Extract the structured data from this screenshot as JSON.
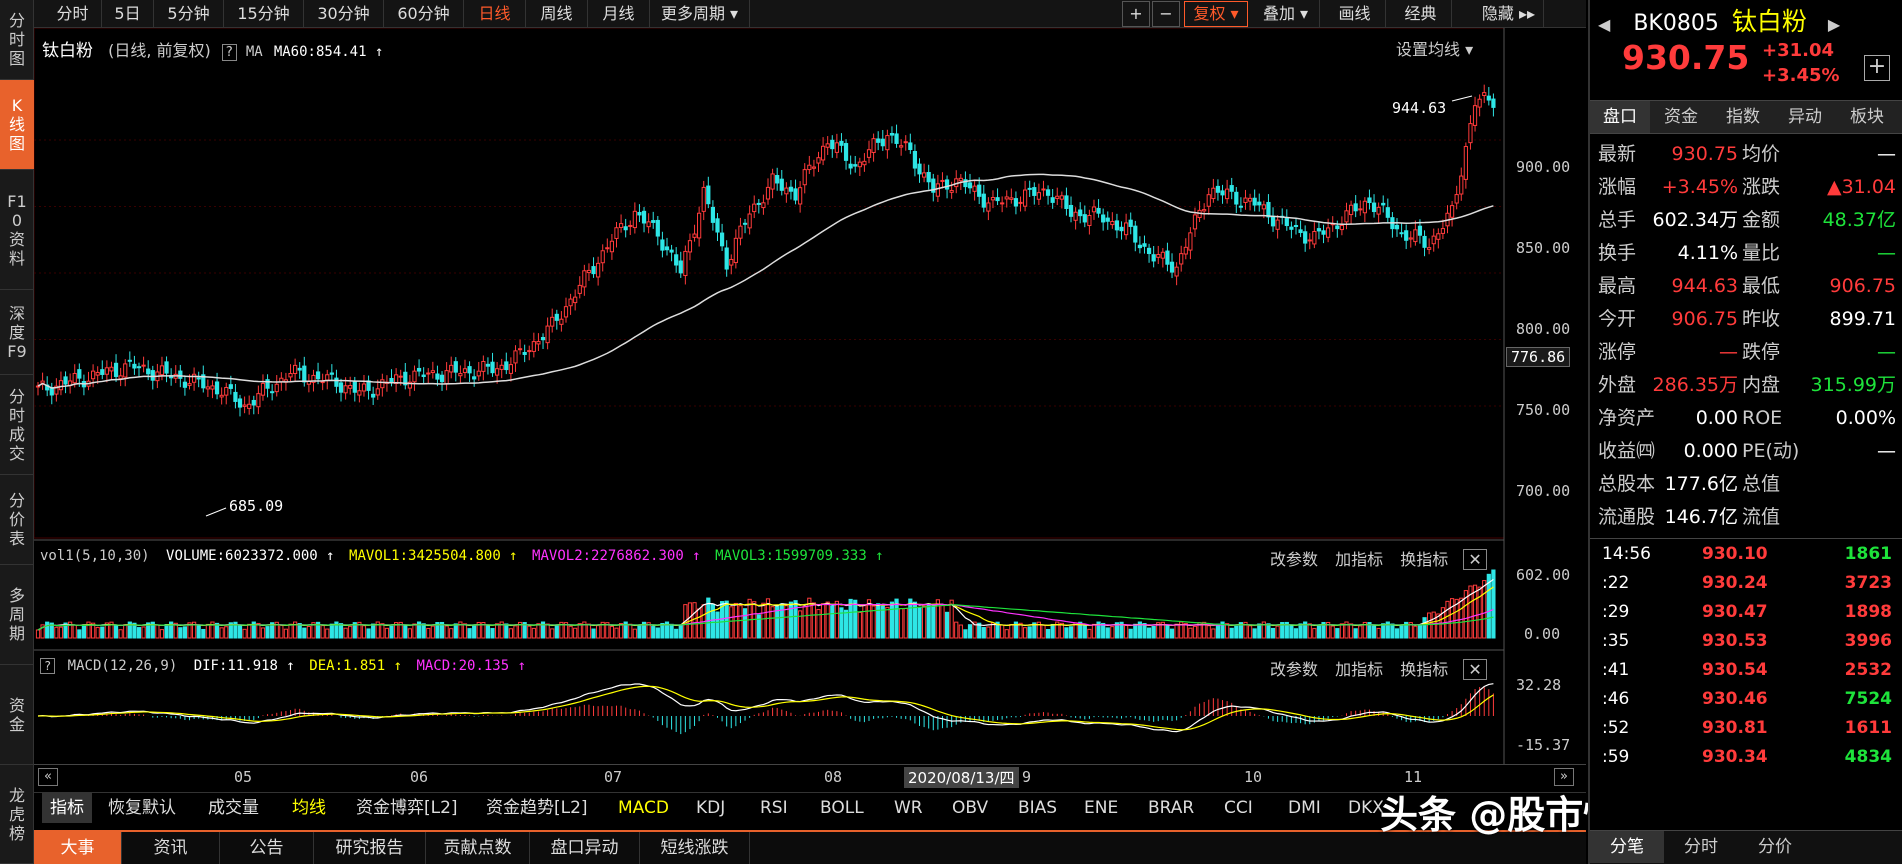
{
  "left_sidebar": [
    {
      "label": "分时图"
    },
    {
      "label": "K线图"
    },
    {
      "label": "F10资料"
    },
    {
      "label": "深度F9"
    },
    {
      "label": "分时成交"
    },
    {
      "label": "分价表"
    },
    {
      "label": "多周期"
    },
    {
      "label": "资金"
    },
    {
      "label": "龙虎榜"
    }
  ],
  "toolbar": {
    "periods": [
      "分时",
      "5日",
      "5分钟",
      "15分钟",
      "30分钟",
      "60分钟",
      "日线",
      "周线",
      "月线",
      "更多周期 ▾"
    ],
    "active_period": "日线",
    "plus": "+",
    "minus": "−",
    "fuquan": "复权 ▾",
    "diejia": "叠加 ▾",
    "huaxian": "画线",
    "jingdian": "经典",
    "yincang": "隐藏 ▸▸"
  },
  "chart_header": {
    "name": "钛白粉",
    "mode": "(日线, 前复权)",
    "help": "?",
    "ma_label": "MA",
    "ma60": "MA60:854.41 ↑",
    "set_ma": "设置均线 ▾"
  },
  "price_axis": [
    "900.00",
    "850.00",
    "800.00",
    "776.86",
    "750.00",
    "700.00"
  ],
  "annotations": {
    "high": "944.63",
    "low": "685.09"
  },
  "volume_header": {
    "title": "vol1(5,10,30)",
    "volume": "VOLUME:6023372.000 ↑",
    "mavol1": "MAVOL1:3425504.800 ↑",
    "mavol2": "MAVOL2:2276862.300 ↑",
    "mavol3": "MAVOL3:1599709.333 ↑",
    "actions": [
      "改参数",
      "加指标",
      "换指标"
    ],
    "axis": [
      "602.00",
      "0.00"
    ]
  },
  "macd_header": {
    "help": "?",
    "title": "MACD(12,26,9)",
    "dif": "DIF:11.918 ↑",
    "dea": "DEA:1.851 ↑",
    "macd": "MACD:20.135 ↑",
    "actions": [
      "改参数",
      "加指标",
      "换指标"
    ],
    "axis": [
      "32.28",
      "-15.37"
    ]
  },
  "x_axis": {
    "labels": [
      "05",
      "06",
      "07",
      "08",
      "9",
      "10",
      "11"
    ],
    "cursor_date": "2020/08/13/四"
  },
  "indicator_bar": [
    "指标",
    "恢复默认",
    "成交量",
    "均线",
    "资金博弈[L2]",
    "资金趋势[L2]",
    "MACD",
    "KDJ",
    "RSI",
    "BOLL",
    "WR",
    "OBV",
    "BIAS",
    "ENE",
    "BRAR",
    "CCI",
    "DMI",
    "DKX"
  ],
  "bottom_tabs": [
    "大事",
    "资讯",
    "公告",
    "研究报告",
    "贡献点数",
    "盘口异动",
    "短线涨跌"
  ],
  "watermark": "头条 @股市情感解析员",
  "right_panel": {
    "code": "BK0805",
    "name": "钛白粉",
    "price": "930.75",
    "change": "+31.04",
    "change_pct": "+3.45%",
    "tabs": [
      "盘口",
      "资金",
      "指数",
      "异动",
      "板块"
    ],
    "stats": [
      {
        "l1": "最新",
        "v1": "930.75",
        "c1": "red",
        "l2": "均价",
        "v2": "—",
        "c2": "wht"
      },
      {
        "l1": "涨幅",
        "v1": "+3.45%",
        "c1": "red",
        "l2": "涨跌",
        "v2": "▲31.04",
        "c2": "red"
      },
      {
        "l1": "总手",
        "v1": "602.34万",
        "c1": "wht",
        "l2": "金额",
        "v2": "48.37亿",
        "c2": "grn"
      },
      {
        "l1": "换手",
        "v1": "4.11%",
        "c1": "wht",
        "l2": "量比",
        "v2": "—",
        "c2": "grn"
      },
      {
        "l1": "最高",
        "v1": "944.63",
        "c1": "red",
        "l2": "最低",
        "v2": "906.75",
        "c2": "red"
      },
      {
        "l1": "今开",
        "v1": "906.75",
        "c1": "red",
        "l2": "昨收",
        "v2": "899.71",
        "c2": "wht"
      },
      {
        "l1": "涨停",
        "v1": "—",
        "c1": "red",
        "l2": "跌停",
        "v2": "—",
        "c2": "grn"
      },
      {
        "l1": "外盘",
        "v1": "286.35万",
        "c1": "red",
        "l2": "内盘",
        "v2": "315.99万",
        "c2": "grn"
      },
      {
        "l1": "净资产",
        "v1": "0.00",
        "c1": "wht",
        "l2": "ROE",
        "v2": "0.00%",
        "c2": "wht"
      },
      {
        "l1": "收益㈣",
        "v1": "0.000",
        "c1": "wht",
        "l2": "PE(动)",
        "v2": "—",
        "c2": "wht"
      },
      {
        "l1": "总股本",
        "v1": "177.6亿",
        "c1": "wht",
        "l2": "总值",
        "v2": "",
        "c2": "wht"
      },
      {
        "l1": "流通股",
        "v1": "146.7亿",
        "c1": "wht",
        "l2": "流值",
        "v2": "",
        "c2": "wht"
      }
    ],
    "ticks": [
      {
        "t": "14:56",
        "p": "930.10",
        "v": "1861",
        "vc": "grn"
      },
      {
        "t": ":22",
        "p": "930.24",
        "v": "3723",
        "vc": "red"
      },
      {
        "t": ":29",
        "p": "930.47",
        "v": "1898",
        "vc": "red"
      },
      {
        "t": ":35",
        "p": "930.53",
        "v": "3996",
        "vc": "red"
      },
      {
        "t": ":41",
        "p": "930.54",
        "v": "2532",
        "vc": "red"
      },
      {
        "t": ":46",
        "p": "930.46",
        "v": "7524",
        "vc": "grn"
      },
      {
        "t": ":52",
        "p": "930.81",
        "v": "1611",
        "vc": "red"
      },
      {
        "t": ":59",
        "p": "930.34",
        "v": "4834",
        "vc": "grn"
      }
    ],
    "bottom_tabs": [
      "分笔",
      "分时",
      "分价"
    ]
  },
  "colors": {
    "up": "#ff3b3b",
    "down": "#2ee6e6",
    "ma": "#ffffff",
    "mavol1": "#ffffff",
    "mavol2": "#ffff00",
    "mavol3": "#ff33ff",
    "accent": "#e8622c"
  }
}
